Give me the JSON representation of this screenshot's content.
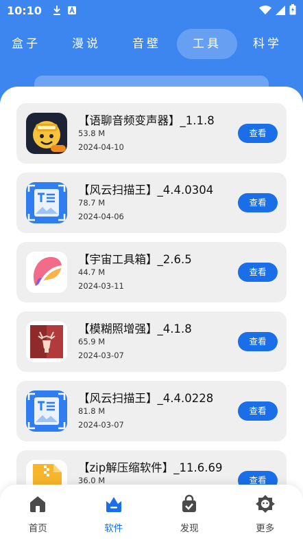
{
  "status_bar": {
    "time": "10:10"
  },
  "tabs": [
    {
      "label": "盒子",
      "active": false
    },
    {
      "label": "漫说",
      "active": false
    },
    {
      "label": "音壁",
      "active": false
    },
    {
      "label": "工具",
      "active": true
    },
    {
      "label": "科学",
      "active": false
    }
  ],
  "apps": [
    {
      "name": "【语聊音频变声器】_1.1.8",
      "size": "53.8 M",
      "date": "2024-04-10",
      "button": "查看",
      "icon": "voice-changer-icon"
    },
    {
      "name": "【风云扫描王】_4.4.0304",
      "size": "78.7 M",
      "date": "2024-04-06",
      "button": "查看",
      "icon": "scanner-icon"
    },
    {
      "name": "【宇宙工具箱】_2.6.5",
      "size": "44.7 M",
      "date": "2024-03-11",
      "button": "查看",
      "icon": "toolbox-icon"
    },
    {
      "name": "【模糊照增强】_4.1.8",
      "size": "65.9 M",
      "date": "2024-03-07",
      "button": "查看",
      "icon": "photo-enhance-icon"
    },
    {
      "name": "【风云扫描王】_4.4.0228",
      "size": "81.8 M",
      "date": "2024-03-07",
      "button": "查看",
      "icon": "scanner-icon"
    },
    {
      "name": "【zip解压缩软件】_11.6.69",
      "size": "36.0 M",
      "date": "",
      "button": "查看",
      "icon": "zip-icon"
    }
  ],
  "bottom_nav": [
    {
      "label": "首页",
      "icon": "home-icon",
      "active": false
    },
    {
      "label": "软件",
      "icon": "software-icon",
      "active": true
    },
    {
      "label": "发现",
      "icon": "discover-icon",
      "active": false
    },
    {
      "label": "更多",
      "icon": "more-icon",
      "active": false
    }
  ],
  "colors": {
    "header_blue": "#3d86f0",
    "accent": "#1a6fe8",
    "card_bg": "#efefef"
  }
}
